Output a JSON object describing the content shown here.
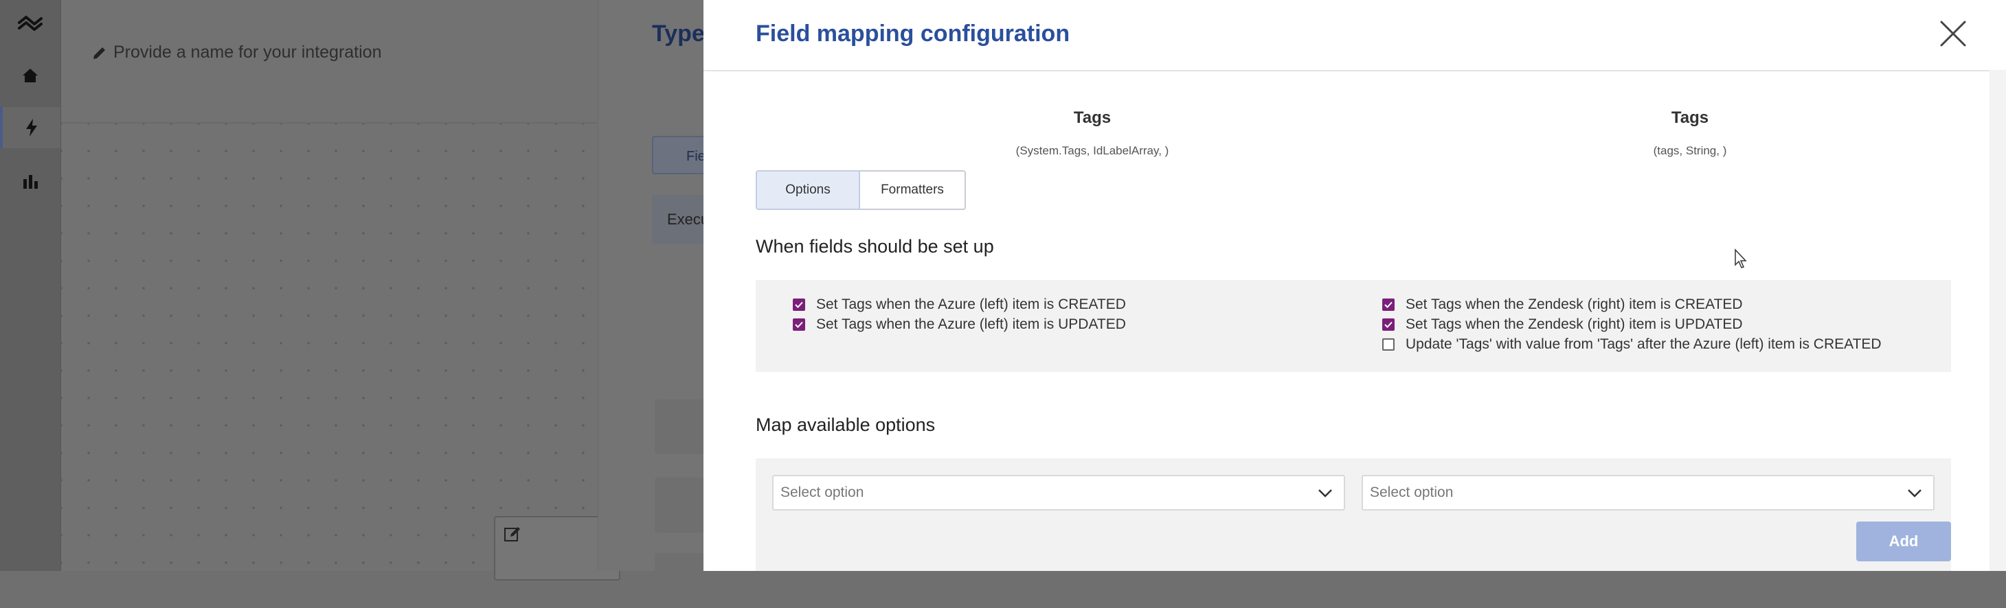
{
  "nav": {
    "items": [
      {
        "icon": "logo-icon"
      },
      {
        "icon": "home-icon"
      },
      {
        "icon": "lightning-icon"
      },
      {
        "icon": "bar-chart-icon"
      }
    ]
  },
  "integration": {
    "name_placeholder": "Provide a name for your integration"
  },
  "side_panel": {
    "title": "Type",
    "tab_label": "Fie",
    "execution_label": "Execu"
  },
  "modal": {
    "title": "Field mapping configuration",
    "left_field": {
      "name": "Tags",
      "type": "(System.Tags, IdLabelArray, )"
    },
    "right_field": {
      "name": "Tags",
      "type": "(tags, String, )"
    },
    "tabs": [
      {
        "label": "Options",
        "active": true
      },
      {
        "label": "Formatters",
        "active": false
      }
    ],
    "setup_heading": "When fields should be set up",
    "checks_left": [
      {
        "label": "Set Tags when the Azure (left) item is CREATED",
        "checked": true
      },
      {
        "label": "Set Tags when the Azure (left) item is UPDATED",
        "checked": true
      }
    ],
    "checks_right": [
      {
        "label": "Set Tags when the Zendesk (right) item is CREATED",
        "checked": true
      },
      {
        "label": "Set Tags when the Zendesk (right) item is UPDATED",
        "checked": true
      },
      {
        "label": "Update 'Tags' with value from 'Tags' after the Azure (left) item is CREATED",
        "checked": false
      }
    ],
    "map_heading": "Map available options",
    "left_select_placeholder": "Select option",
    "right_select_placeholder": "Select option",
    "add_button": "Add"
  },
  "colors": {
    "title_blue": "#2a4f9c",
    "checkbox_purple": "#7a1f7a",
    "add_button_bg": "#9fb3de",
    "active_tab_bg": "#e4ebf7"
  }
}
